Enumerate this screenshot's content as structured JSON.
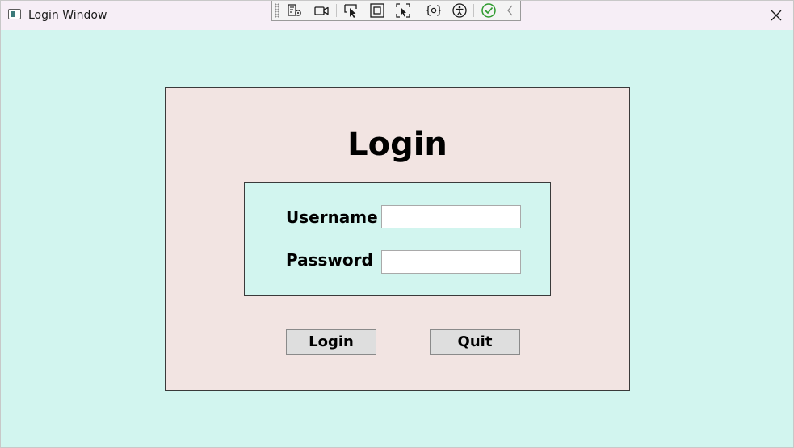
{
  "window": {
    "title": "Login Window",
    "colors": {
      "titlebar": "#f6eef6",
      "background": "#d2f5ef",
      "panel": "#f2e4e2",
      "form_box": "#d2f5ef",
      "button": "#dedede"
    }
  },
  "debug_toolbar": {
    "icons": [
      "live-visual-tree-icon",
      "record-video-icon",
      "select-element-icon",
      "display-layout-adorners-icon",
      "track-focused-element-icon",
      "binding-failures-icon",
      "accessibility-icon",
      "check-icon",
      "collapse-toolbar-icon"
    ]
  },
  "login": {
    "heading": "Login",
    "username_label": "Username",
    "username_value": "",
    "password_label": "Password",
    "password_value": "",
    "login_button": "Login",
    "quit_button": "Quit"
  }
}
